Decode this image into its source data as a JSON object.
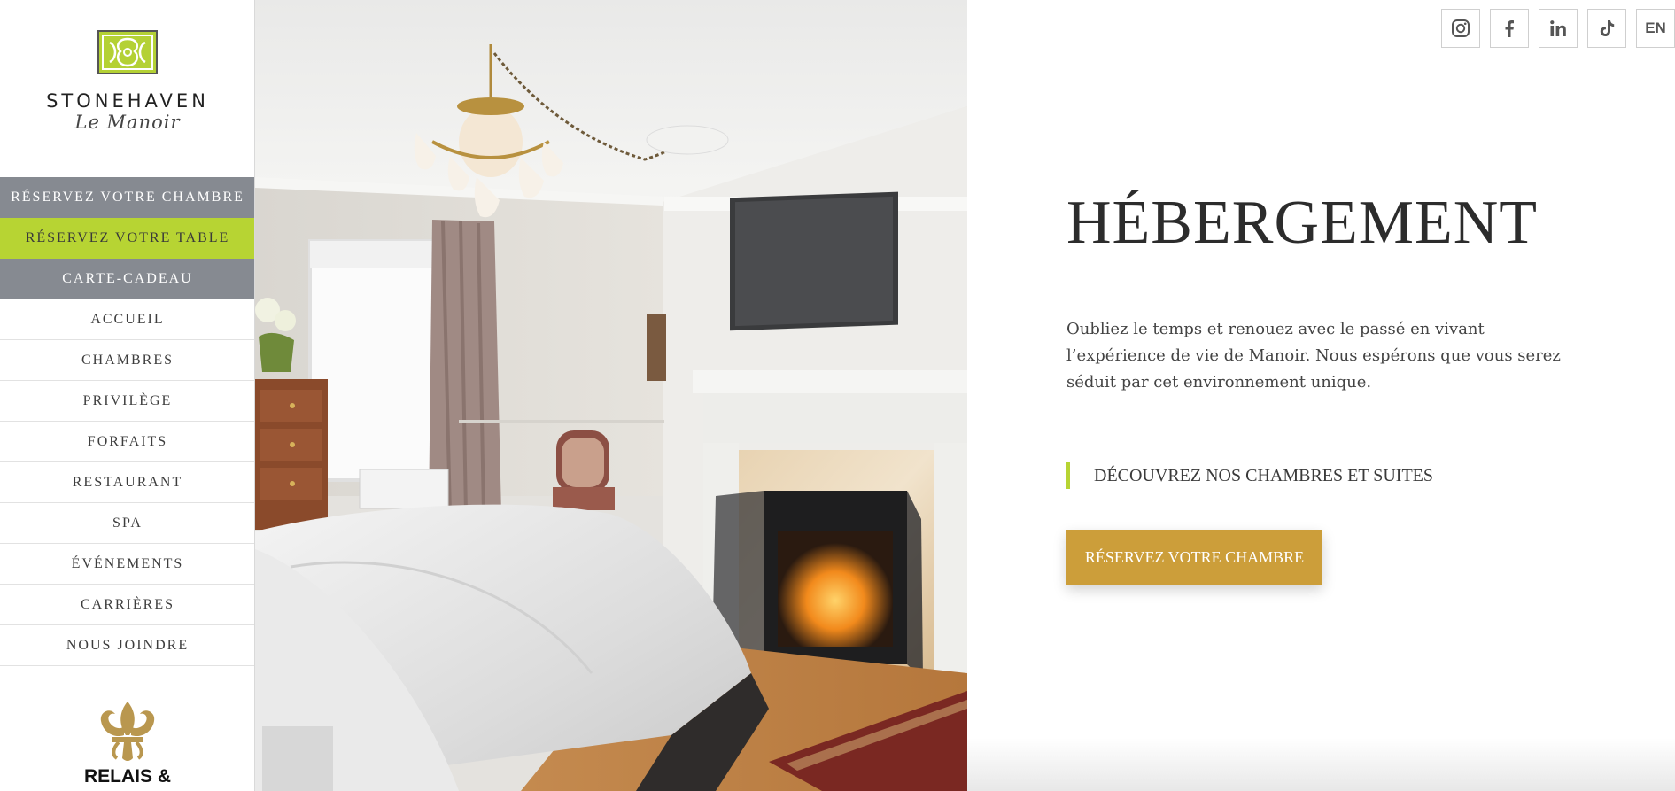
{
  "brand": {
    "name": "STONEHAVEN",
    "subname": "Le Manoir"
  },
  "sidebar": {
    "items": [
      {
        "label": "RÉSERVEZ VOTRE CHAMBRE",
        "style": "gray"
      },
      {
        "label": "RÉSERVEZ VOTRE TABLE",
        "style": "green"
      },
      {
        "label": "CARTE-CADEAU",
        "style": "gray"
      },
      {
        "label": "ACCUEIL",
        "style": "plain"
      },
      {
        "label": "CHAMBRES",
        "style": "plain"
      },
      {
        "label": "PRIVILÈGE",
        "style": "plain"
      },
      {
        "label": "FORFAITS",
        "style": "plain"
      },
      {
        "label": "RESTAURANT",
        "style": "plain"
      },
      {
        "label": "SPA",
        "style": "plain"
      },
      {
        "label": "ÉVÉNEMENTS",
        "style": "plain"
      },
      {
        "label": "CARRIÈRES",
        "style": "plain"
      },
      {
        "label": "NOUS JOINDRE",
        "style": "plain"
      }
    ],
    "relais_logo_text": "RELAIS &"
  },
  "header": {
    "socials": [
      {
        "icon": "instagram-icon"
      },
      {
        "icon": "facebook-icon"
      },
      {
        "icon": "linkedin-icon"
      },
      {
        "icon": "tiktok-icon"
      }
    ],
    "language": "EN"
  },
  "main": {
    "title": "HÉBERGEMENT",
    "intro": "Oubliez le temps et renouez avec le passé en vivant l’expérience de vie de Manoir. Nous espérons que vous serez séduit par cet environnement unique.",
    "discover_link": "DÉCOUVREZ NOS CHAMBRES ET SUITES",
    "cta_label": "RÉSERVEZ VOTRE CHAMBRE"
  },
  "colors": {
    "sidebar_gray": "#868a91",
    "accent_green": "#b7d433",
    "cta_gold": "#cc9e3a",
    "fleur_gold": "#b9974f"
  }
}
